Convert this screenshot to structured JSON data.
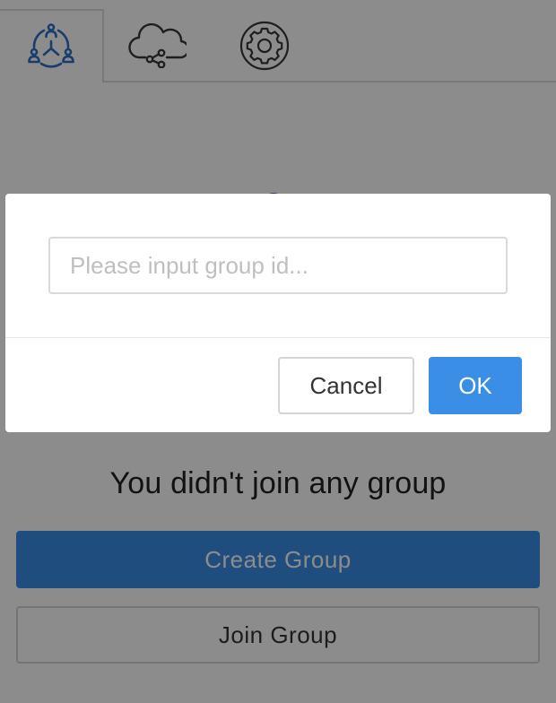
{
  "tabs": [
    {
      "icon": "groups-icon",
      "active": true
    },
    {
      "icon": "cloud-share-icon",
      "active": false
    },
    {
      "icon": "gear-icon",
      "active": false
    }
  ],
  "colors": {
    "accent": "#3a8ee6",
    "active_icon": "#2f6fc4",
    "inactive_icon": "#3a3a3a"
  },
  "empty_state": {
    "message": "You didn't join any group",
    "create_label": "Create Group",
    "join_label": "Join Group"
  },
  "dialog": {
    "input_placeholder": "Please input group id...",
    "input_value": "",
    "cancel_label": "Cancel",
    "ok_label": "OK"
  }
}
